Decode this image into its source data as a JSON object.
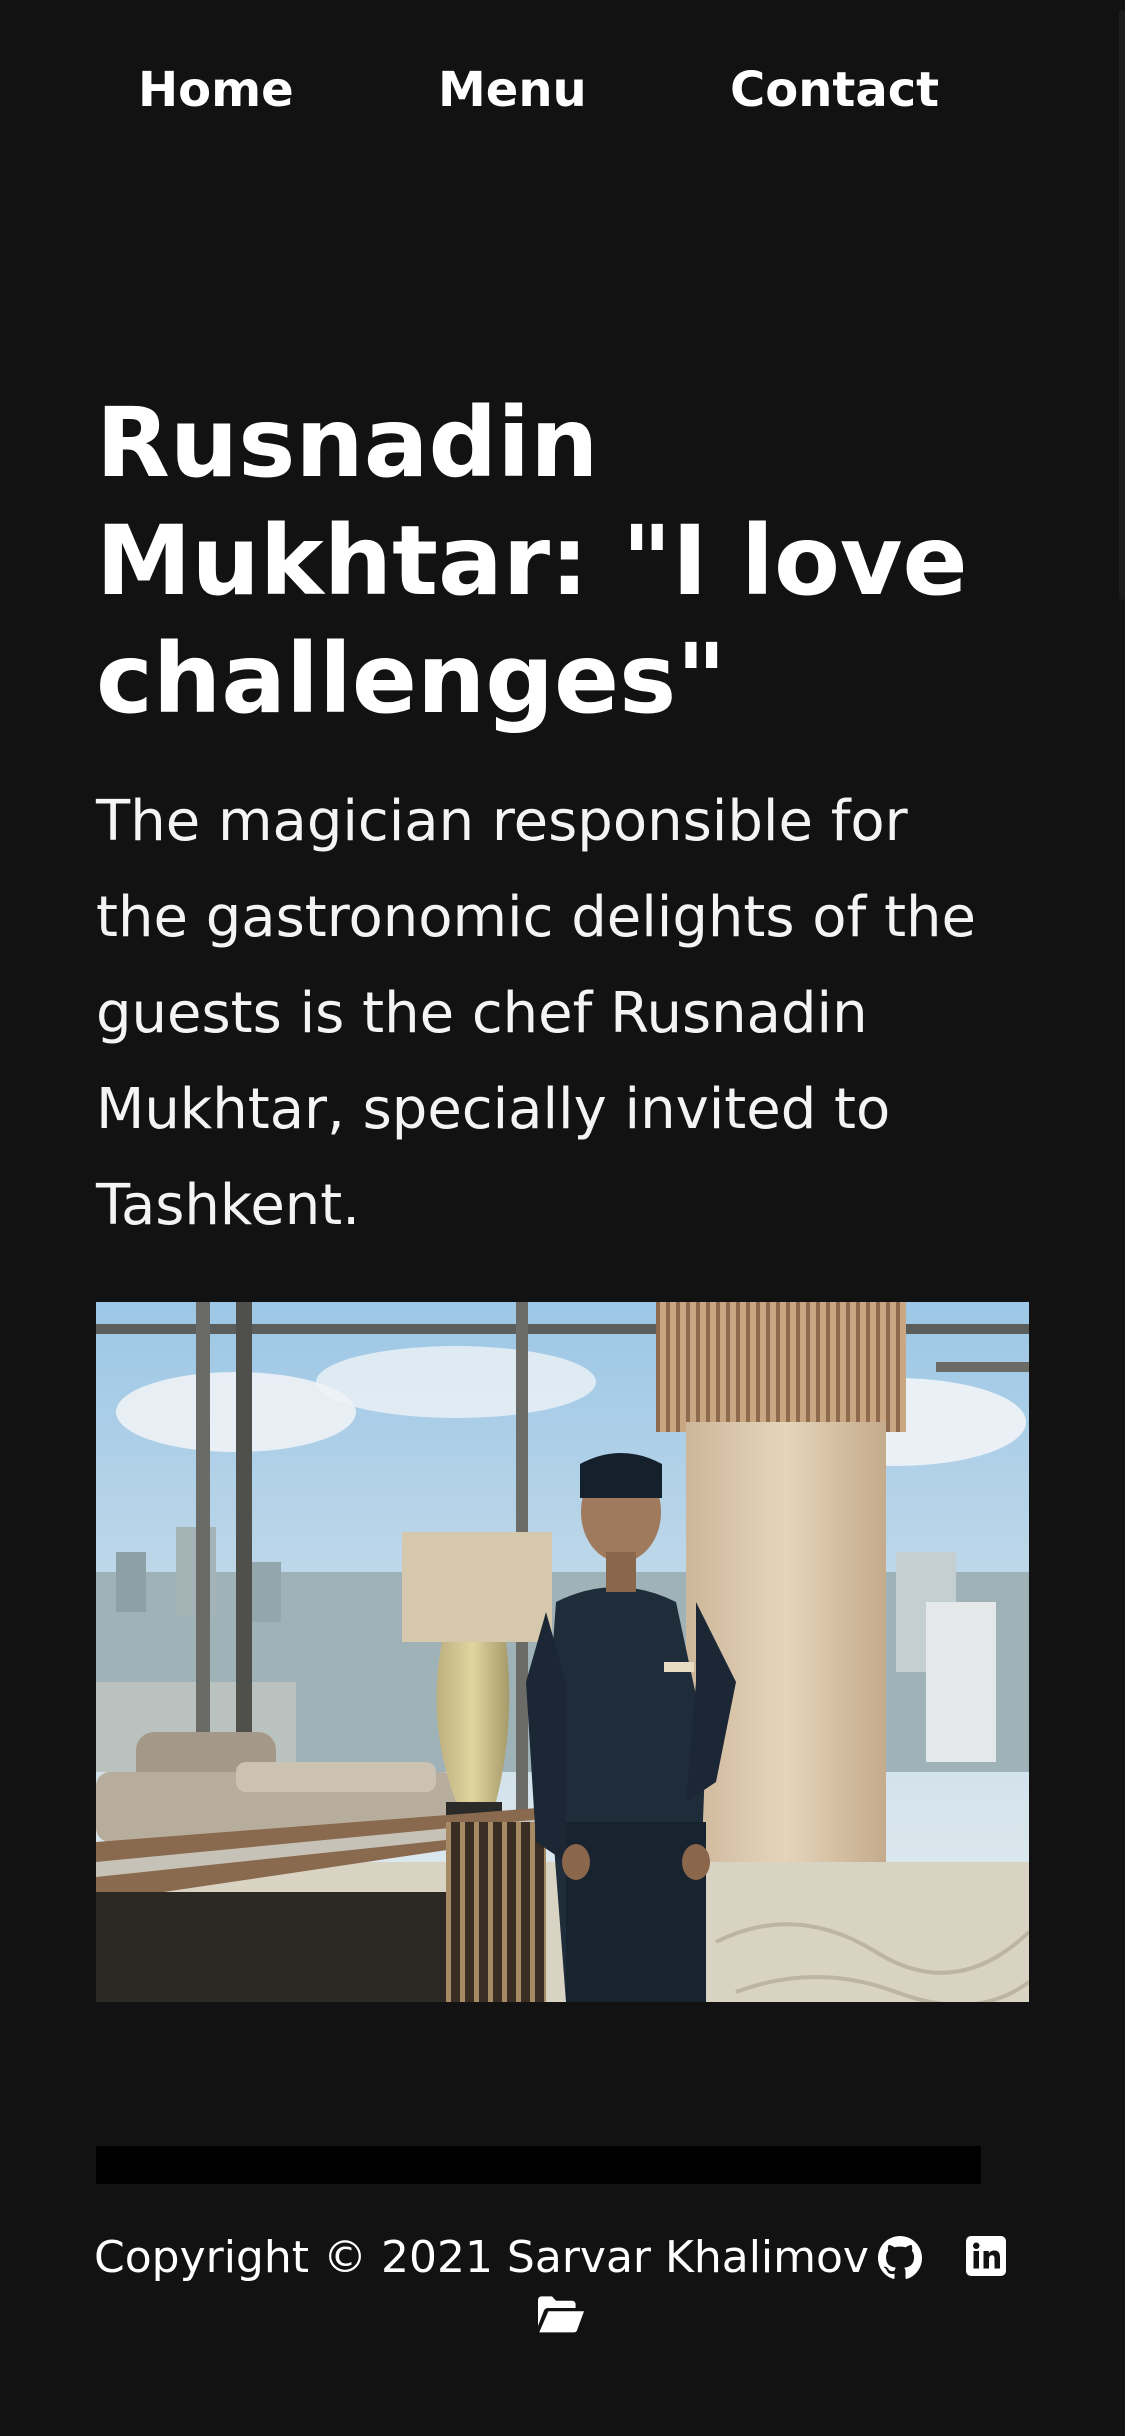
{
  "nav": {
    "items": [
      {
        "label": "Home"
      },
      {
        "label": "Menu"
      },
      {
        "label": "Contact"
      }
    ]
  },
  "article": {
    "title": "Rusnadin Mukhtar: \"I love challenges\"",
    "lead": "The magician responsible for the gastronomic delights of the guests is the chef Rusnadin Mukhtar, specially invited to Tashkent."
  },
  "footer": {
    "copyright": "Copyright © 2021 Sarvar Khalimov",
    "icons": [
      "github-icon",
      "linkedin-icon",
      "folder-open-icon"
    ]
  },
  "colors": {
    "background": "#121212",
    "text": "#ffffff",
    "divider": "#000000"
  }
}
